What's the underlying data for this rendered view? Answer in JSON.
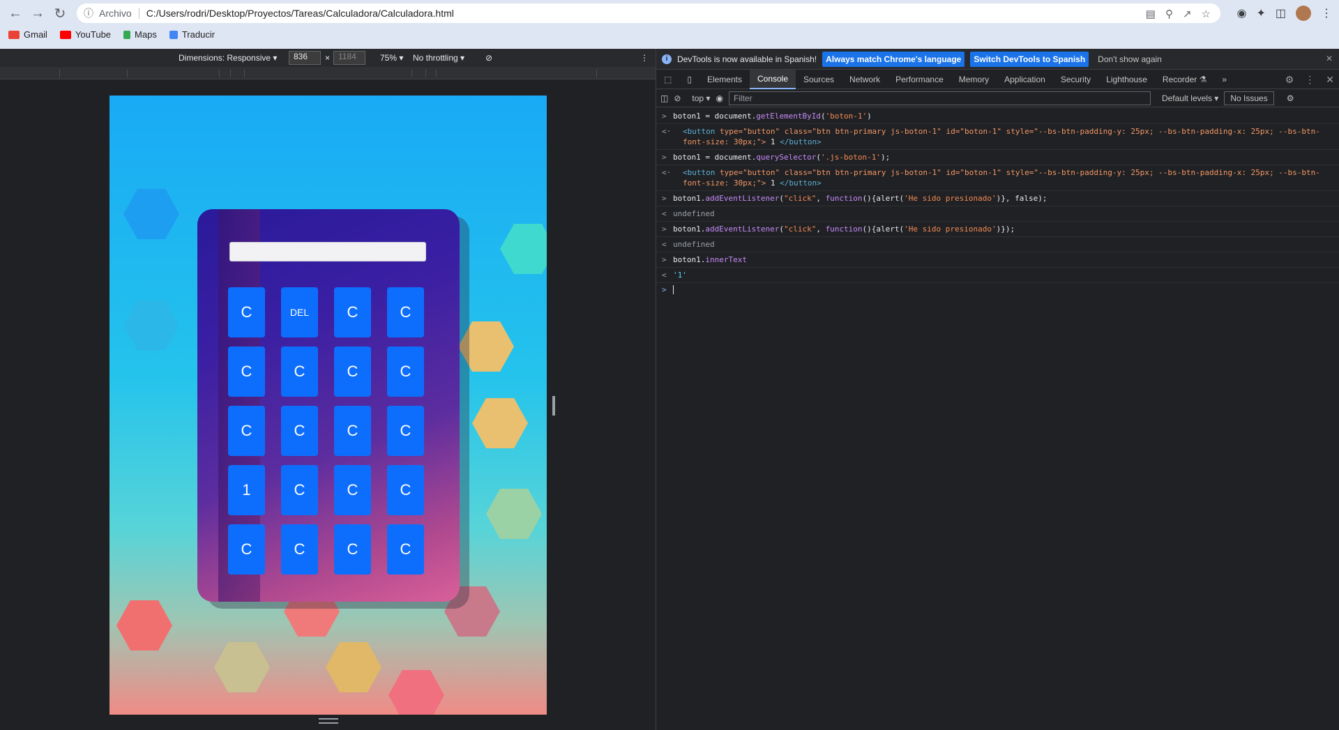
{
  "browser": {
    "scheme": "Archivo",
    "url": "C:/Users/rodri/Desktop/Proyectos/Tareas/Calculadora/Calculadora.html",
    "bookmarks": [
      "Gmail",
      "YouTube",
      "Maps",
      "Traducir"
    ]
  },
  "device_toolbar": {
    "dimensions": "Dimensions: Responsive ▾",
    "width": "836",
    "height": "1184",
    "times": "×",
    "zoom": "75% ▾",
    "throttling": "No throttling ▾"
  },
  "calculator": {
    "display_value": "",
    "keys": [
      "C",
      "DEL",
      "C",
      "C",
      "C",
      "C",
      "C",
      "C",
      "C",
      "C",
      "C",
      "C",
      "1",
      "C",
      "C",
      "C",
      "C",
      "C",
      "C",
      "C"
    ]
  },
  "devtools": {
    "info_text": "DevTools is now available in Spanish!",
    "btn_match": "Always match Chrome's language",
    "btn_switch": "Switch DevTools to Spanish",
    "btn_dont": "Don't show again",
    "tabs": [
      "Elements",
      "Console",
      "Sources",
      "Network",
      "Performance",
      "Memory",
      "Application",
      "Security",
      "Lighthouse",
      "Recorder ⚗"
    ],
    "context": "top ▾",
    "filter_placeholder": "Filter",
    "levels": "Default levels ▾",
    "issues": "No Issues"
  },
  "console": {
    "l1_var": "boton1 = document.",
    "l1_fn": "getElementById",
    "l1_arg": "'boton-1'",
    "l2_open": "<button",
    "l2_attrs": " type=\"button\" class=\"btn btn-primary js-boton-1\" id=\"boton-1\" style=\"--bs-btn-padding-y: 25px; --bs-btn-padding-x: 25px; --bs-btn-font-size: 30px;\">",
    "l2_text": " 1 ",
    "l2_close": "</button>",
    "l3_var": "boton1 = document.",
    "l3_fn": "querySelector",
    "l3_arg": "'.js-boton-1'",
    "l4_attrs": " type=\"button\" class=\"btn btn-primary js-boton-1\" id=\"boton-1\" style=\"--bs-btn-padding-y: 25px; --bs-btn-padding-x: 25px; --bs-btn-font-size: 30px;\">",
    "l5_a": "boton1.",
    "l5_fn": "addEventListener",
    "l5_str": "\"click\"",
    "l5_kw": "function",
    "l5_alert": "(){alert(",
    "l5_msg": "'He sido presionado'",
    "l5_end": ")}, false);",
    "undefined": "undefined",
    "l7_end": ")});",
    "l9_a": "boton1.",
    "l9_prop": "innerText",
    "l10": "'1'"
  }
}
